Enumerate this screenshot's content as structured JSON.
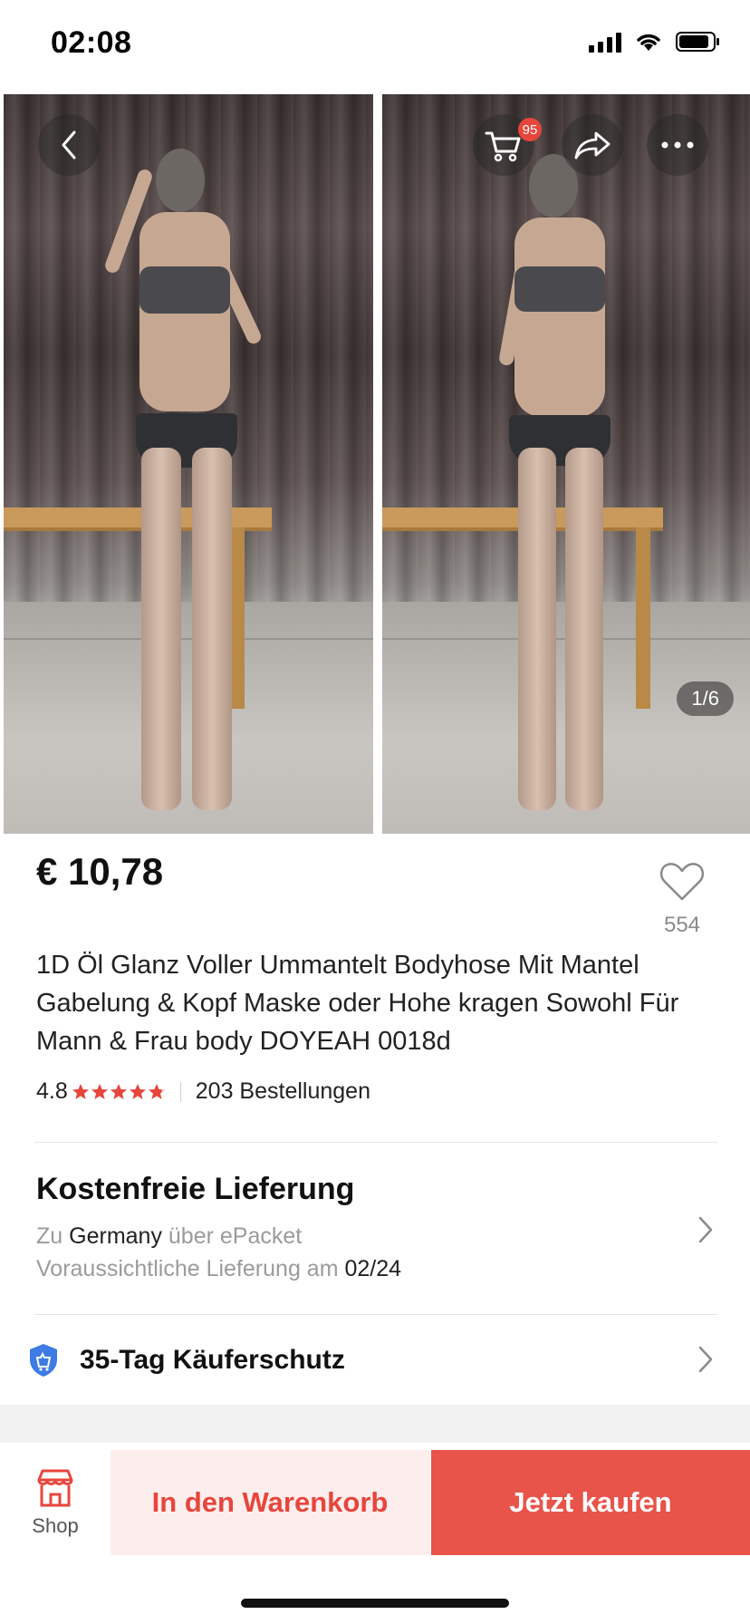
{
  "status_bar": {
    "time": "02:08",
    "icons": [
      "signal-icon",
      "wifi-icon",
      "battery-icon"
    ]
  },
  "gallery": {
    "cart_badge": "95",
    "image_counter": "1/6",
    "buttons": [
      "back-icon",
      "cart-icon",
      "share-icon",
      "more-icon"
    ]
  },
  "product": {
    "price": "€ 10,78",
    "wishlist_count": "554",
    "title": "1D Öl Glanz Voller Ummantelt Bodyhose Mit Mantel Gabelung & Kopf Maske oder Hohe kragen Sowohl Für Mann & Frau body DOYEAH 0018d",
    "rating": "4.8",
    "rating_value": 4.8,
    "orders": "203 Bestellungen"
  },
  "delivery": {
    "title": "Kostenfreie Lieferung",
    "to_prefix": "Zu",
    "country": "Germany",
    "via": "über ePacket",
    "eta_prefix": "Voraussichtliche Lieferung am",
    "eta_date": "02/24"
  },
  "protection": {
    "label": "35-Tag Käuferschutz"
  },
  "bottom_bar": {
    "shop_label": "Shop",
    "add_to_cart": "In den Warenkorb",
    "buy_now": "Jetzt kaufen"
  },
  "colors": {
    "accent": "#e8453c",
    "cart_bg": "#fdeeee",
    "shield": "#3d7be5"
  }
}
